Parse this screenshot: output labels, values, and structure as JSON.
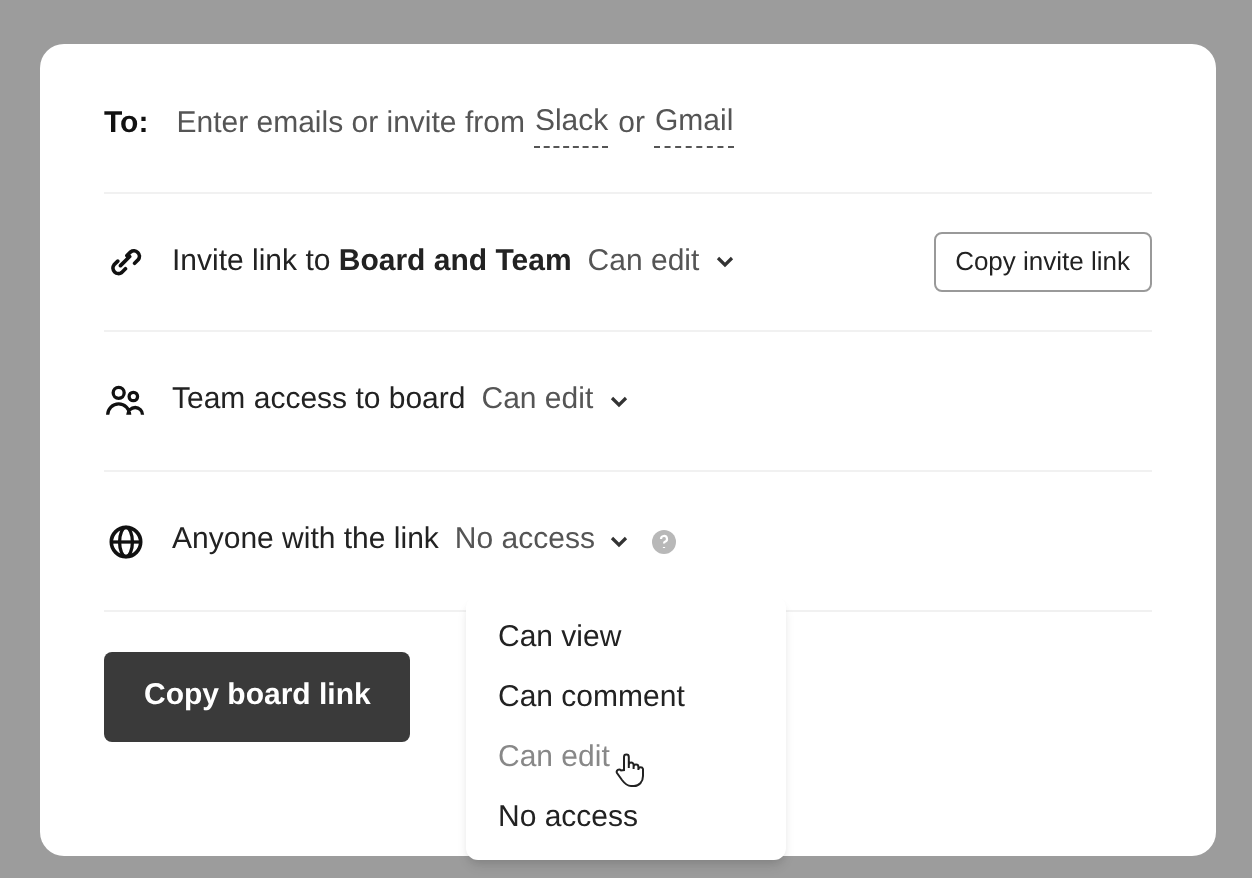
{
  "to": {
    "label": "To:",
    "text": "Enter emails or invite from",
    "links": [
      {
        "label": "Slack"
      },
      {
        "label": "Gmail"
      }
    ],
    "joiner": "or"
  },
  "rows": [
    {
      "kind": "link",
      "text": "Invite link to **Board and Team**",
      "permission": "Can edit",
      "button": "Copy invite link"
    },
    {
      "kind": "team",
      "text": "Team access to board",
      "permission": "Can edit"
    },
    {
      "kind": "globe",
      "text": "Anyone with the link",
      "permission": "No access"
    }
  ],
  "primary_button": "Copy board link",
  "dropdown": {
    "items": [
      {
        "label": "Can view",
        "hovered": false
      },
      {
        "label": "Can comment",
        "hovered": false
      },
      {
        "label": "Can edit",
        "hovered": true
      },
      {
        "label": "No access",
        "hovered": false
      }
    ]
  }
}
